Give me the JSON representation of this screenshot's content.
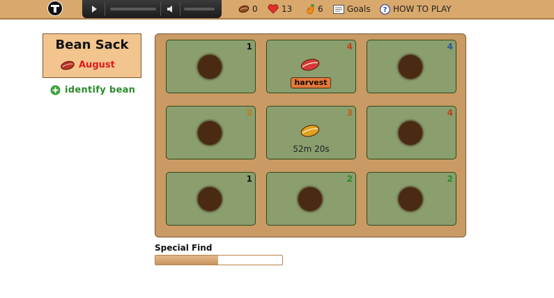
{
  "topbar": {
    "beans_count": "0",
    "hearts_count": "13",
    "fire_count": "6",
    "goals_label": "Goals",
    "howto_label": "HOW TO PLAY"
  },
  "bean_sack": {
    "title": "Bean Sack",
    "bean_name": "August",
    "bean_color": "#e01a1a"
  },
  "identify": {
    "label": "identify bean"
  },
  "plots": [
    {
      "num": "1",
      "num_color": "#111111",
      "state": "empty"
    },
    {
      "num": "4",
      "num_color": "#c0401a",
      "state": "ready",
      "bean_color": "#d9383a",
      "action_label": "harvest"
    },
    {
      "num": "4",
      "num_color": "#2a5aa0",
      "state": "empty"
    },
    {
      "num": "2",
      "num_color": "#c07a1a",
      "state": "empty"
    },
    {
      "num": "3",
      "num_color": "#c0601a",
      "state": "growing",
      "bean_color": "#e0a020",
      "timer": "52m 20s"
    },
    {
      "num": "4",
      "num_color": "#c0401a",
      "state": "empty"
    },
    {
      "num": "1",
      "num_color": "#111111",
      "state": "empty"
    },
    {
      "num": "2",
      "num_color": "#2a8a2a",
      "state": "empty"
    },
    {
      "num": "2",
      "num_color": "#2a8a2a",
      "state": "empty"
    }
  ],
  "special_find": {
    "label": "Special Find",
    "progress": 0.495
  },
  "icons": [
    "logo-icon",
    "play-icon",
    "volume-icon",
    "bean-icon",
    "heart-icon",
    "fire-icon",
    "goals-icon",
    "help-icon",
    "plus-circle-icon"
  ]
}
